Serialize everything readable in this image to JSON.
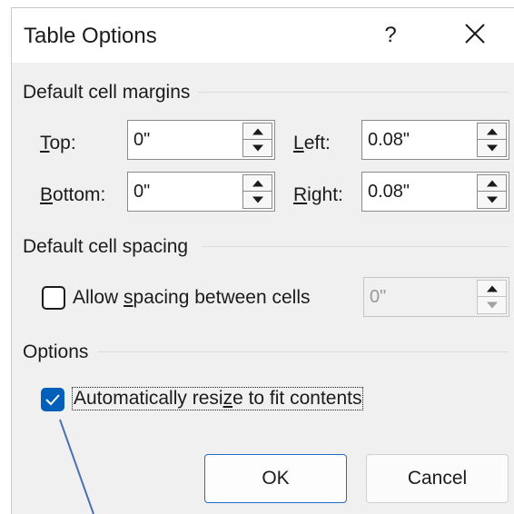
{
  "window": {
    "title": "Table Options",
    "help_label": "?",
    "close_icon": "close-icon"
  },
  "margins": {
    "group_label": "Default cell margins",
    "top": {
      "label_u": "T",
      "label_rest": "op:",
      "value": "0\""
    },
    "bottom": {
      "label_u": "B",
      "label_rest": "ottom:",
      "value": "0\""
    },
    "left": {
      "label_u": "L",
      "label_rest": "eft:",
      "value": "0.08\""
    },
    "right": {
      "label_u": "R",
      "label_rest": "ight:",
      "value": "0.08\""
    }
  },
  "spacing": {
    "group_label": "Default cell spacing",
    "checkbox_label_pre": "Allow ",
    "checkbox_label_u": "s",
    "checkbox_label_post": "pacing between cells",
    "checked": false,
    "value": "0\"",
    "enabled": false
  },
  "options": {
    "group_label": "Options",
    "autoresize_pre": "Automatically resi",
    "autoresize_u": "z",
    "autoresize_post": "e to fit contents",
    "checked": true
  },
  "buttons": {
    "ok": "OK",
    "cancel": "Cancel"
  },
  "colors": {
    "accent": "#005fb8",
    "dialog_bg": "#f0f0f0",
    "annotation_line": "#4a6fb5"
  }
}
